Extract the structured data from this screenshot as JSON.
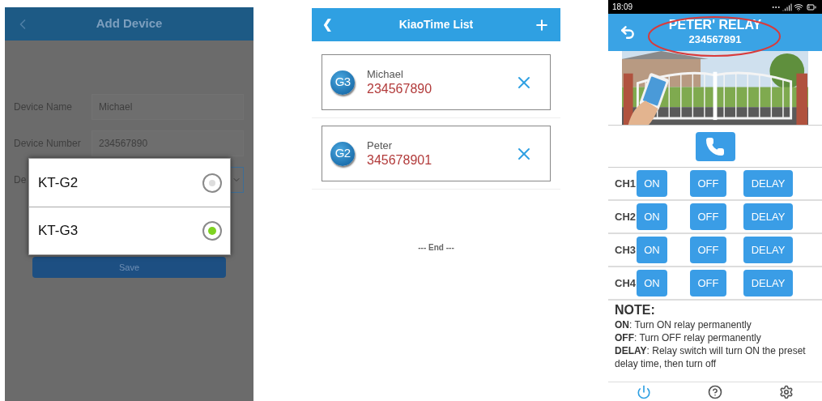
{
  "add_device": {
    "title": "Add Device",
    "fields": [
      {
        "label": "Device Name",
        "value": "Michael"
      },
      {
        "label": "Device Number",
        "value": "234567890"
      }
    ],
    "type_label": "De",
    "save_button": "Save",
    "dialog": {
      "options": [
        {
          "label": "KT-G2",
          "selected": false
        },
        {
          "label": "KT-G3",
          "selected": true
        }
      ]
    }
  },
  "device_list": {
    "title": "KiaoTime List",
    "back": "❮",
    "items": [
      {
        "model": "G3",
        "name": "Michael",
        "number": "234567890"
      },
      {
        "model": "G2",
        "name": "Peter",
        "number": "345678901"
      }
    ],
    "end_text": "--- End ---"
  },
  "relay": {
    "status_bar": {
      "time": "18:09"
    },
    "title": "PETER' RELAY",
    "number": "234567891",
    "channels": [
      {
        "label": "CH1",
        "buttons": [
          "ON",
          "OFF",
          "DELAY"
        ]
      },
      {
        "label": "CH2",
        "buttons": [
          "ON",
          "OFF",
          "DELAY"
        ]
      },
      {
        "label": "CH3",
        "buttons": [
          "ON",
          "OFF",
          "DELAY"
        ]
      },
      {
        "label": "CH4",
        "buttons": [
          "ON",
          "OFF",
          "DELAY"
        ]
      }
    ],
    "note": {
      "heading": "NOTE:",
      "lines": [
        "**ON**: Turn ON relay permanently",
        "**OFF**: Turn OFF relay permanently",
        "**DELAY**: Relay switch will turn ON the preset delay time, then turn off"
      ]
    },
    "nav": [
      {
        "kind": "power",
        "selected": true
      },
      {
        "kind": "help",
        "selected": false
      },
      {
        "kind": "settings",
        "selected": false
      }
    ]
  }
}
